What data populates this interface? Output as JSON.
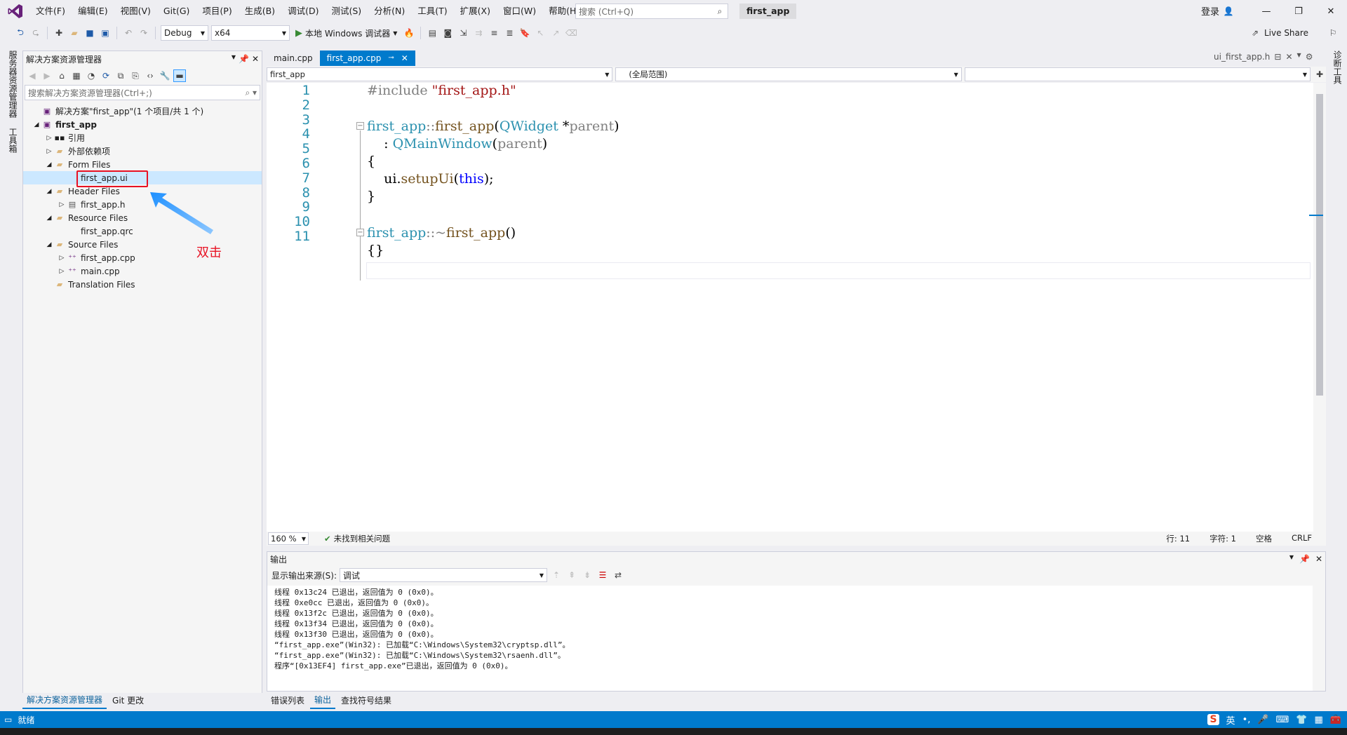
{
  "menu": [
    "文件(F)",
    "编辑(E)",
    "视图(V)",
    "Git(G)",
    "项目(P)",
    "生成(B)",
    "调试(D)",
    "测试(S)",
    "分析(N)",
    "工具(T)",
    "扩展(X)",
    "窗口(W)",
    "帮助(H)"
  ],
  "search_placeholder": "搜索 (Ctrl+Q)",
  "solution_name": "first_app",
  "login": "登录",
  "toolbar": {
    "config": "Debug",
    "platform": "x64",
    "run_label": "本地 Windows 调试器",
    "live_share": "Live Share"
  },
  "left_strip": [
    "服务器资源管理器",
    "工具箱"
  ],
  "right_strip": [
    "诊断工具"
  ],
  "solution_explorer": {
    "title": "解决方案资源管理器",
    "search_placeholder": "搜索解决方案资源管理器(Ctrl+;)",
    "tree": [
      {
        "label": "解决方案\"first_app\"(1 个项目/共 1 个)",
        "level": 0,
        "expander": "",
        "icon": "solution-icon"
      },
      {
        "label": "first_app",
        "level": 0,
        "expander": "◢",
        "icon": "project-icon",
        "bold": true
      },
      {
        "label": "引用",
        "level": 1,
        "expander": "▷",
        "icon": "references-icon"
      },
      {
        "label": "外部依赖项",
        "level": 1,
        "expander": "▷",
        "icon": "folder-icon"
      },
      {
        "label": "Form Files",
        "level": 1,
        "expander": "◢",
        "icon": "folder-icon"
      },
      {
        "label": "first_app.ui",
        "level": 2,
        "expander": "",
        "icon": "",
        "selected": true
      },
      {
        "label": "Header Files",
        "level": 1,
        "expander": "◢",
        "icon": "folder-icon"
      },
      {
        "label": "first_app.h",
        "level": 2,
        "expander": "▷",
        "icon": "header-file-icon"
      },
      {
        "label": "Resource Files",
        "level": 1,
        "expander": "◢",
        "icon": "folder-icon"
      },
      {
        "label": "first_app.qrc",
        "level": 2,
        "expander": "",
        "icon": ""
      },
      {
        "label": "Source Files",
        "level": 1,
        "expander": "◢",
        "icon": "folder-icon"
      },
      {
        "label": "first_app.cpp",
        "level": 2,
        "expander": "▷",
        "icon": "cpp-file-icon"
      },
      {
        "label": "main.cpp",
        "level": 2,
        "expander": "▷",
        "icon": "cpp-file-icon"
      },
      {
        "label": "Translation Files",
        "level": 1,
        "expander": "",
        "icon": "folder-icon"
      }
    ],
    "bottom_tabs": [
      "解决方案资源管理器",
      "Git 更改"
    ]
  },
  "annotation": "双击",
  "editor": {
    "tabs": [
      "main.cpp",
      "first_app.cpp"
    ],
    "preview_tab": "ui_first_app.h",
    "nav_project": "first_app",
    "nav_scope": "(全局范围)",
    "line_numbers": [
      "1",
      "2",
      "3",
      "4",
      "5",
      "6",
      "7",
      "8",
      "9",
      "10",
      "11"
    ],
    "code": {
      "l1_pp": "#include ",
      "l1_str": "\"first_app.h\"",
      "l3_a": "first_app",
      "l3_b": "::",
      "l3_c": "first_app",
      "l3_d": "(",
      "l3_e": "QWidget",
      "l3_f": " *",
      "l3_g": "parent",
      "l3_h": ")",
      "l4_a": "    : ",
      "l4_b": "QMainWindow",
      "l4_c": "(",
      "l4_d": "parent",
      "l4_e": ")",
      "l5": "{",
      "l6_a": "    ui.",
      "l6_b": "setupUi",
      "l6_c": "(",
      "l6_d": "this",
      "l6_e": ");",
      "l7": "}",
      "l9_a": "first_app",
      "l9_b": "::~",
      "l9_c": "first_app",
      "l9_d": "()",
      "l10": "{}"
    },
    "zoom": "160 %",
    "issues": "未找到相关问题",
    "position": {
      "line": "行: 11",
      "char": "字符: 1",
      "ws": "空格",
      "eol": "CRLF"
    }
  },
  "output": {
    "title": "输出",
    "source_label": "显示输出来源(S):",
    "source_value": "调试",
    "lines": [
      "线程 0x13c24 已退出，返回值为 0 (0x0)。",
      "线程 0xe0cc 已退出，返回值为 0 (0x0)。",
      "线程 0x13f2c 已退出，返回值为 0 (0x0)。",
      "线程 0x13f34 已退出，返回值为 0 (0x0)。",
      "线程 0x13f30 已退出，返回值为 0 (0x0)。",
      "“first_app.exe”(Win32): 已加载“C:\\Windows\\System32\\cryptsp.dll”。",
      "“first_app.exe”(Win32): 已加载“C:\\Windows\\System32\\rsaenh.dll”。",
      "程序“[0x13EF4] first_app.exe”已退出，返回值为 0 (0x0)。"
    ]
  },
  "bottom_tabs": [
    "错误列表",
    "输出",
    "查找符号结果"
  ],
  "status": "就绪",
  "ime": {
    "logo": "S",
    "lang": "英"
  },
  "colors": {
    "accent": "#007acc",
    "highlight": "#e81123"
  }
}
